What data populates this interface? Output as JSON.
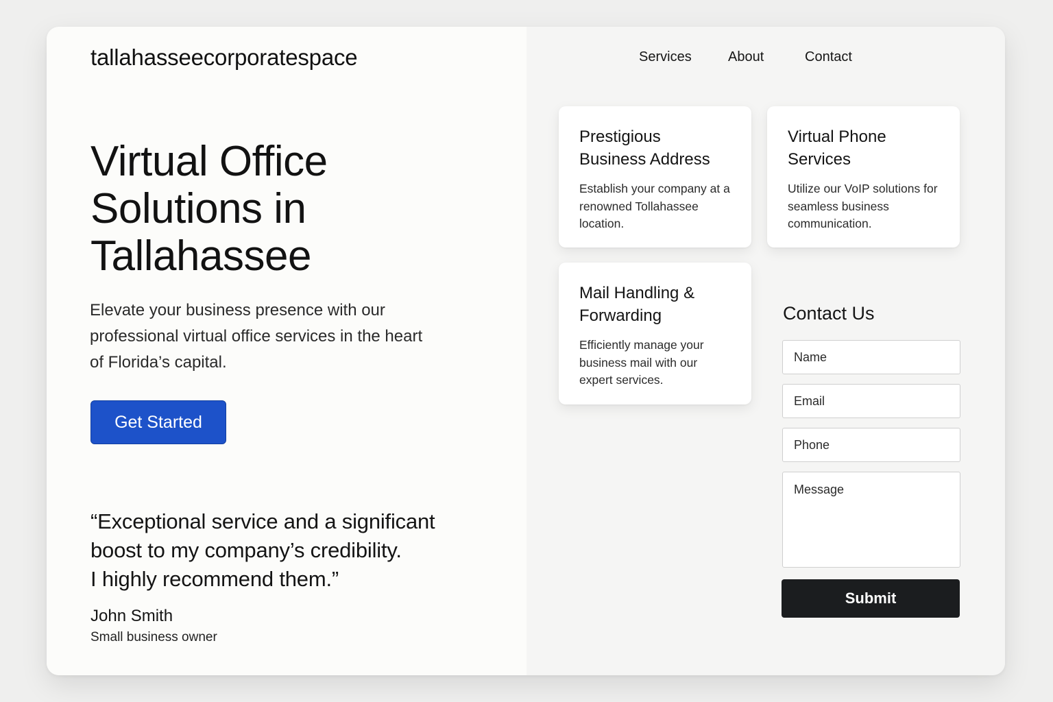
{
  "brand": "tallahasseecorporatespace",
  "nav": {
    "items": [
      {
        "label": "Services"
      },
      {
        "label": "About"
      },
      {
        "label": "Contact"
      }
    ]
  },
  "hero": {
    "title": "Virtual Office Solutions in Tallahassee",
    "subtitle": "Elevate your business presence with our professional virtual office services in the heart of Florida’s capital.",
    "cta_label": "Get Started",
    "cta_color": "#1d52c9"
  },
  "testimonial": {
    "quote_lines": [
      "“Exceptional service and a significant",
      "boost to my company’s credibility.",
      "I highly recommend them.”"
    ],
    "author": "John Smith",
    "role": "Small business owner"
  },
  "services": [
    {
      "title": "Prestigious Business Address",
      "description": "Establish your company at a renowned Tollahassee location."
    },
    {
      "title": "Virtual Phone Services",
      "description": "Utilize our VoIP solutions for seamless business communication."
    },
    {
      "title": "Mail Handling & Forwarding",
      "description": "Efficiently manage your business mail with our expert services."
    }
  ],
  "contact_form": {
    "title": "Contact Us",
    "name_placeholder": "Name",
    "email_placeholder": "Email",
    "phone_placeholder": "Phone",
    "message_placeholder": "Message",
    "submit_label": "Submit",
    "submit_color": "#1b1d1f"
  }
}
